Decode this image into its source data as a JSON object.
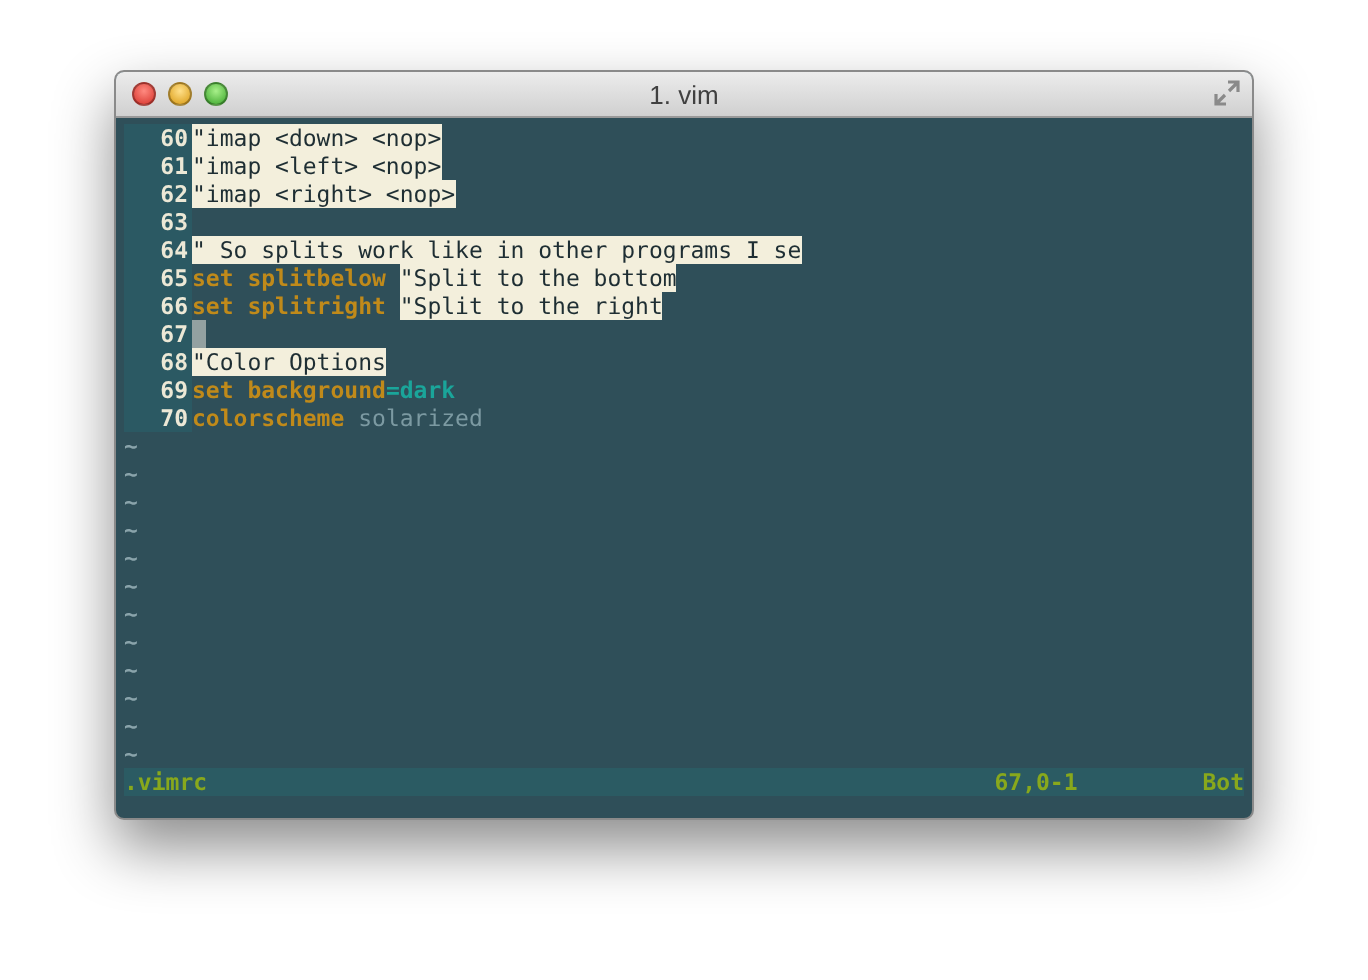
{
  "window": {
    "title": "1. vim"
  },
  "lines": [
    {
      "number": "60",
      "segments": [
        {
          "kind": "comment",
          "text": "\"imap <down> <nop>"
        }
      ]
    },
    {
      "number": "61",
      "segments": [
        {
          "kind": "comment",
          "text": "\"imap <left> <nop>"
        }
      ]
    },
    {
      "number": "62",
      "segments": [
        {
          "kind": "comment",
          "text": "\"imap <right> <nop>"
        }
      ]
    },
    {
      "number": "63"
    },
    {
      "number": "64",
      "segments": [
        {
          "kind": "comment",
          "text": "\" So splits work like in other programs I se"
        }
      ]
    },
    {
      "number": "65",
      "segments": [
        {
          "kind": "keyword",
          "text": "set splitbelow"
        },
        {
          "kind": "comment",
          "text": "\"Split to the bottom"
        }
      ]
    },
    {
      "number": "66",
      "segments": [
        {
          "kind": "keyword",
          "text": "set splitright"
        },
        {
          "kind": "comment",
          "text": "\"Split to the right"
        }
      ]
    },
    {
      "number": "67",
      "cursor": true
    },
    {
      "number": "68",
      "segments": [
        {
          "kind": "comment",
          "text": "\"Color Options"
        }
      ]
    },
    {
      "number": "69",
      "segments": [
        {
          "kind": "keyword",
          "text": "set background"
        },
        {
          "kind": "value",
          "text": "=dark"
        }
      ]
    },
    {
      "number": "70",
      "segments": [
        {
          "kind": "keyword",
          "text": "colorscheme"
        },
        {
          "kind": "dim",
          "text": " solarized"
        }
      ]
    }
  ],
  "empty_lines": [
    "~",
    "~",
    "~",
    "~",
    "~",
    "~",
    "~",
    "~",
    "~",
    "~",
    "~",
    "~"
  ],
  "status_bar": {
    "file": ".vimrc",
    "position": "67,0-1",
    "scroll": "Bot"
  }
}
